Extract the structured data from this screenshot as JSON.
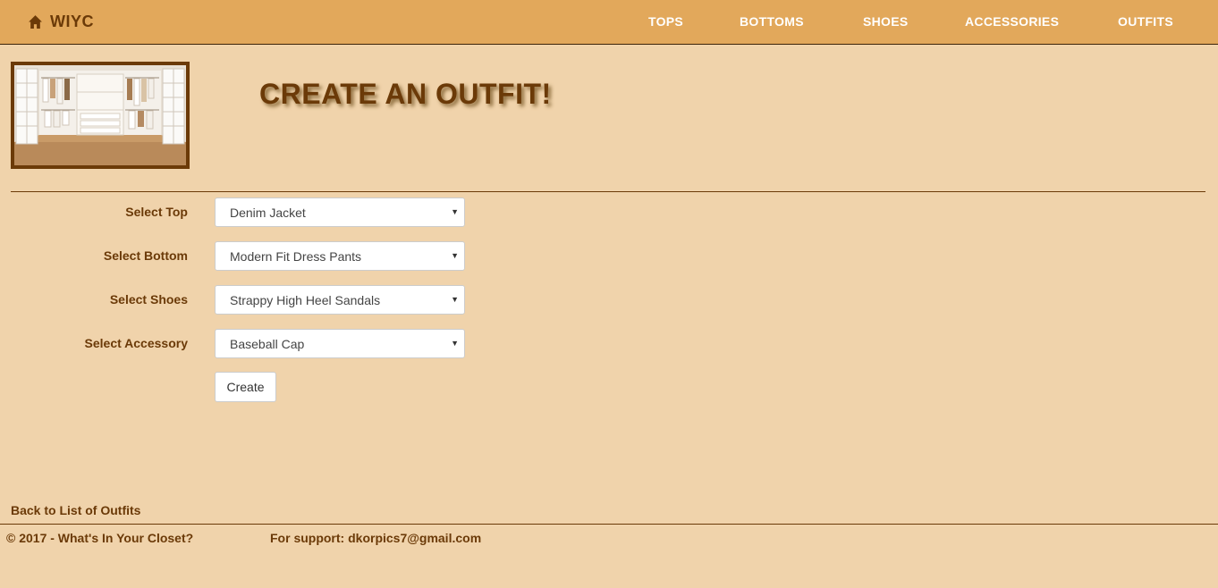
{
  "brand": {
    "name": "WIYC",
    "icon": "home-icon"
  },
  "nav": {
    "items": [
      "TOPS",
      "BOTTOMS",
      "SHOES",
      "ACCESSORIES",
      "OUTFITS"
    ]
  },
  "header": {
    "image": "closet-photo",
    "title": "CREATE AN OUTFIT!"
  },
  "form": {
    "fields": [
      {
        "label": "Select Top",
        "value": "Denim Jacket"
      },
      {
        "label": "Select Bottom",
        "value": "Modern Fit Dress Pants"
      },
      {
        "label": "Select Shoes",
        "value": "Strappy High Heel Sandals"
      },
      {
        "label": "Select Accessory",
        "value": "Baseball Cap"
      }
    ],
    "submit_label": "Create"
  },
  "back_link": "Back to List of Outfits",
  "footer": {
    "copyright": "© 2017 - What's In Your Closet?",
    "support_label": "For support:",
    "support_email": "dkorpics7@gmail.com"
  },
  "colors": {
    "page_bg": "#f0d3ab",
    "navbar_bg": "#e2a85b",
    "brand_text": "#6b3a08",
    "nav_text": "#ffffff"
  }
}
